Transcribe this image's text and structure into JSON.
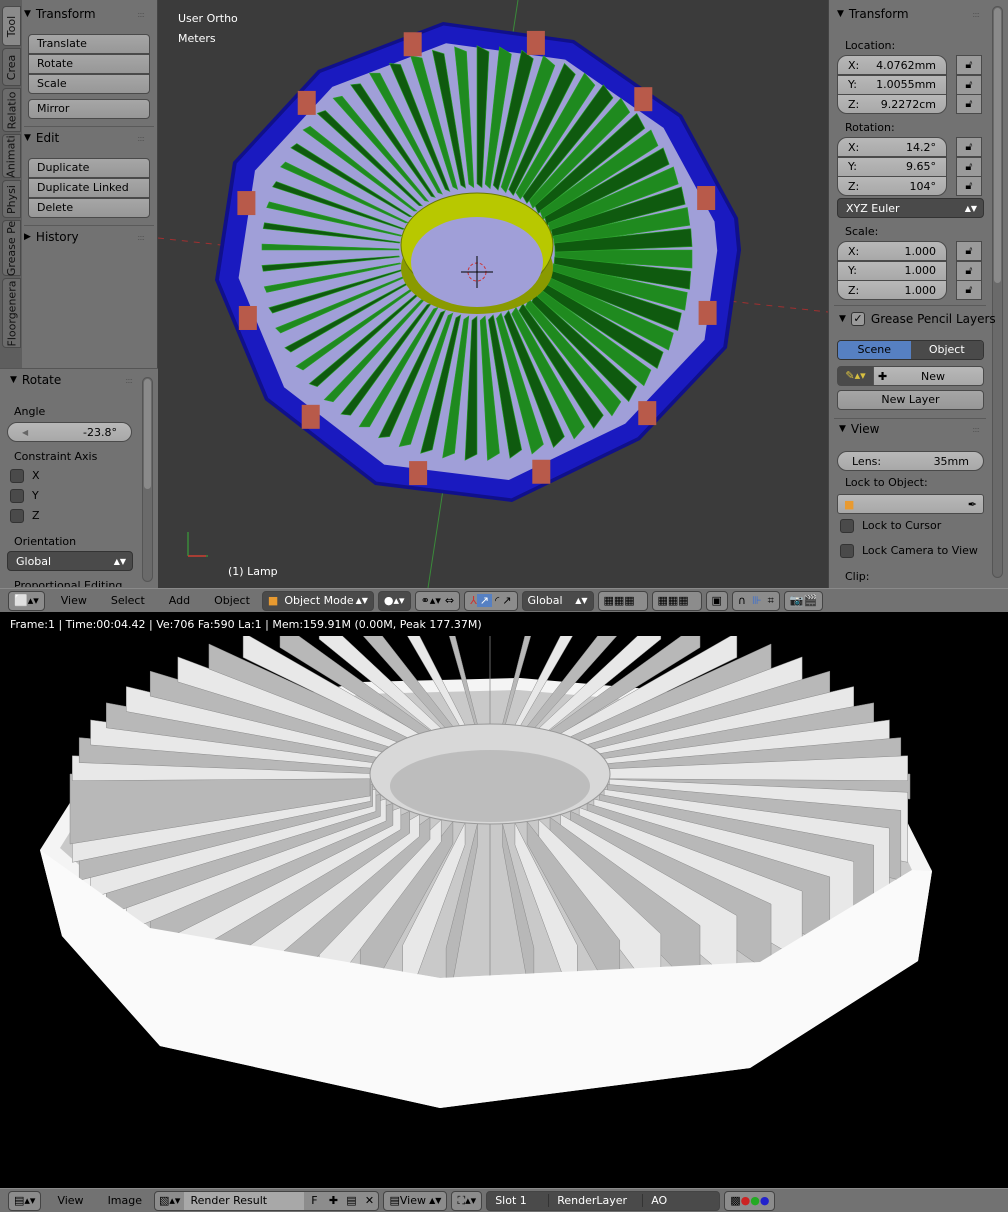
{
  "tool_tabs": [
    "Tool",
    "Crea",
    "Relatio",
    "Animati",
    "Physi",
    "Grease Pe",
    "Floorgenera"
  ],
  "tool_panel": {
    "transform": {
      "title": "Transform",
      "buttons": [
        "Translate",
        "Rotate",
        "Scale"
      ],
      "mirror": "Mirror"
    },
    "edit": {
      "title": "Edit",
      "buttons": [
        "Duplicate",
        "Duplicate Linked",
        "Delete"
      ]
    },
    "history": {
      "title": "History"
    }
  },
  "operator": {
    "title": "Rotate",
    "angle_label": "Angle",
    "angle": "-23.8°",
    "constraint_label": "Constraint Axis",
    "axes": [
      "X",
      "Y",
      "Z"
    ],
    "orientation_label": "Orientation",
    "orientation": "Global",
    "proportional": "Proportional Editing"
  },
  "viewport": {
    "view_name": "User Ortho",
    "units": "Meters",
    "object_label": "(1) Lamp",
    "colors": {
      "rim": "#1a1ac0",
      "floor": "#a09fd8",
      "fins": "#1f8a1f",
      "hub": "#b8c800",
      "tabs": "#b85a4a"
    }
  },
  "properties": {
    "transform": {
      "title": "Transform",
      "location_label": "Location:",
      "location": [
        {
          "k": "X:",
          "v": "4.0762mm"
        },
        {
          "k": "Y:",
          "v": "1.0055mm"
        },
        {
          "k": "Z:",
          "v": "9.2272cm"
        }
      ],
      "rotation_label": "Rotation:",
      "rotation": [
        {
          "k": "X:",
          "v": "14.2°"
        },
        {
          "k": "Y:",
          "v": "9.65°"
        },
        {
          "k": "Z:",
          "v": "104°"
        }
      ],
      "rotation_mode": "XYZ Euler",
      "scale_label": "Scale:",
      "scale": [
        {
          "k": "X:",
          "v": "1.000"
        },
        {
          "k": "Y:",
          "v": "1.000"
        },
        {
          "k": "Z:",
          "v": "1.000"
        }
      ]
    },
    "grease": {
      "title": "Grease Pencil Layers",
      "checked": true,
      "scene": "Scene",
      "object": "Object",
      "new": "New",
      "new_layer": "New Layer"
    },
    "view": {
      "title": "View",
      "lens_label": "Lens:",
      "lens": "35mm",
      "lock_object_label": "Lock to Object:",
      "lock_cursor": "Lock to Cursor",
      "lock_camera": "Lock Camera to View",
      "clip_label": "Clip:"
    }
  },
  "view3d_header": {
    "menus": [
      "View",
      "Select",
      "Add",
      "Object"
    ],
    "mode": "Object Mode",
    "orientation": "Global"
  },
  "info": {
    "stats": "Frame:1 | Time:00:04.42 | Ve:706 Fa:590 La:1 | Mem:159.91M (0.00M, Peak 177.37M)"
  },
  "image_header": {
    "menus": [
      "View",
      "Image"
    ],
    "image_name": "Render Result",
    "fake_user": "F",
    "view": "View",
    "slot": "Slot 1",
    "layer": "RenderLayer",
    "pass": "AO"
  }
}
